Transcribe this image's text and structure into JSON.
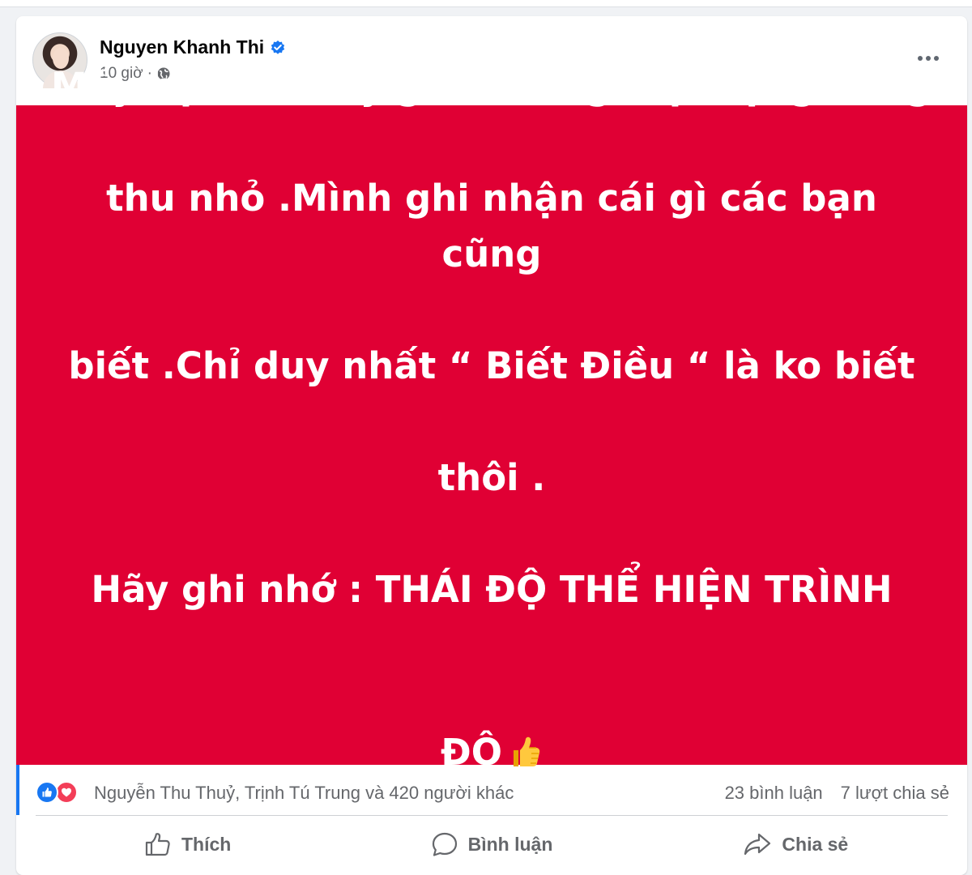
{
  "post": {
    "author": "Nguyen Khanh Thi",
    "time": "10 giờ",
    "separator": "·",
    "text_lines": [
      "Mấy bạn trẻ bây giờ , trong một cộng đồng",
      "thu nhỏ .Mình ghi nhận cái gì các bạn cũng",
      "biết .Chỉ duy nhất “ Biết Điều “ là ko biết",
      "thôi .",
      "Hãy ghi nhớ : THÁI ĐỘ THỂ HIỆN TRÌNH",
      "ĐỘ"
    ],
    "emoji": "thumbs-up",
    "background_color": "#e00034"
  },
  "reactions": {
    "reactors": "Nguyễn Thu Thuỷ, Trịnh Tú Trung và 420 người khác",
    "comments": "23 bình luận",
    "shares": "7 lượt chia sẻ",
    "icons": [
      "like-icon",
      "love-icon"
    ]
  },
  "actions": {
    "like_label": "Thích",
    "comment_label": "Bình luận",
    "share_label": "Chia sẻ"
  },
  "colors": {
    "accent": "#1877f2",
    "love": "#f33e58",
    "muted_text": "#65676b"
  }
}
